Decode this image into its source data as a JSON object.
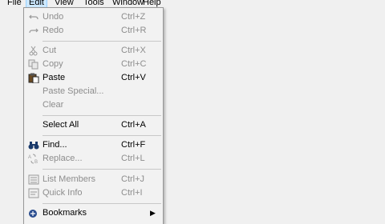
{
  "menubar": {
    "items": [
      {
        "label": "File"
      },
      {
        "label": "Edit"
      },
      {
        "label": "View"
      },
      {
        "label": "Tools"
      },
      {
        "label": "Window"
      },
      {
        "label": "Help"
      }
    ]
  },
  "edit_menu": {
    "items": [
      {
        "label": "Undo",
        "shortcut": "Ctrl+Z",
        "icon": "undo-icon",
        "enabled": false
      },
      {
        "label": "Redo",
        "shortcut": "Ctrl+R",
        "icon": "redo-icon",
        "enabled": false
      },
      {
        "label": "Cut",
        "shortcut": "Ctrl+X",
        "icon": "scissors-icon",
        "enabled": false
      },
      {
        "label": "Copy",
        "shortcut": "Ctrl+C",
        "icon": "copy-icon",
        "enabled": false
      },
      {
        "label": "Paste",
        "shortcut": "Ctrl+V",
        "icon": "clipboard-icon",
        "enabled": true
      },
      {
        "label": "Paste Special...",
        "shortcut": "",
        "icon": "",
        "enabled": false
      },
      {
        "label": "Clear",
        "shortcut": "",
        "icon": "",
        "enabled": false
      },
      {
        "label": "Select All",
        "shortcut": "Ctrl+A",
        "icon": "",
        "enabled": true
      },
      {
        "label": "Find...",
        "shortcut": "Ctrl+F",
        "icon": "binoculars-icon",
        "enabled": true
      },
      {
        "label": "Replace...",
        "shortcut": "Ctrl+L",
        "icon": "replace-icon",
        "enabled": false
      },
      {
        "label": "List Members",
        "shortcut": "Ctrl+J",
        "icon": "list-members-icon",
        "enabled": false
      },
      {
        "label": "Quick Info",
        "shortcut": "Ctrl+I",
        "icon": "quick-info-icon",
        "enabled": false
      },
      {
        "label": "Bookmarks",
        "shortcut": "",
        "icon": "bookmark-icon",
        "enabled": true,
        "submenu": true
      }
    ]
  },
  "colors": {
    "menu_bg": "#f2f2f2",
    "menu_border": "#979797",
    "disabled_text": "#8d8d8d",
    "active_menubar_bg": "#cce8ff"
  }
}
